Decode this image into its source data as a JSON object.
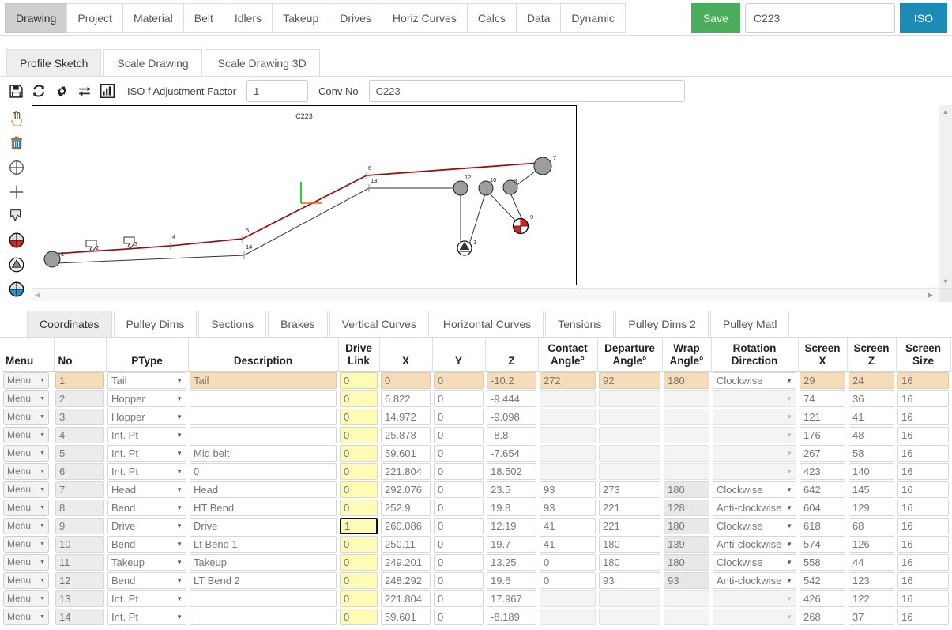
{
  "topnav": {
    "tabs": [
      {
        "label": "Drawing",
        "active": true
      },
      {
        "label": "Project",
        "active": false
      },
      {
        "label": "Material",
        "active": false
      },
      {
        "label": "Belt",
        "active": false
      },
      {
        "label": "Idlers",
        "active": false
      },
      {
        "label": "Takeup",
        "active": false
      },
      {
        "label": "Drives",
        "active": false
      },
      {
        "label": "Horiz Curves",
        "active": false
      },
      {
        "label": "Calcs",
        "active": false
      },
      {
        "label": "Data",
        "active": false
      },
      {
        "label": "Dynamic",
        "active": false
      }
    ],
    "save_label": "Save",
    "conv_value": "C223",
    "iso_label": "ISO",
    "save_color": "#4cae5c",
    "iso_color": "#1b8cb5"
  },
  "subtabs": [
    {
      "label": "Profile Sketch",
      "active": true
    },
    {
      "label": "Scale Drawing",
      "active": false
    },
    {
      "label": "Scale Drawing 3D",
      "active": false
    }
  ],
  "toolbar": {
    "icons": [
      "save-icon",
      "refresh-icon",
      "gear-icon",
      "swap-icon",
      "chart-icon"
    ],
    "factor_label": "ISO f Adjustment Factor",
    "factor_value": "1",
    "convno_label": "Conv No",
    "convno_value": "C223"
  },
  "sidetools": [
    "pan-hand-icon",
    "delete-trash-icon",
    "crosshair-circle-icon",
    "add-plus-icon",
    "pointer-select-icon",
    "red-pulley-icon",
    "takeup-triangle-icon",
    "blue-pulley-icon"
  ],
  "drawing": {
    "title": "C223",
    "point_labels": [
      "1",
      "2",
      "3",
      "4",
      "5",
      "6",
      "7",
      "8",
      "9",
      "10",
      "12",
      "13",
      "14"
    ]
  },
  "lowtabs": [
    {
      "label": "Coordinates",
      "active": true
    },
    {
      "label": "Pulley Dims",
      "active": false
    },
    {
      "label": "Sections",
      "active": false
    },
    {
      "label": "Brakes",
      "active": false
    },
    {
      "label": "Vertical Curves",
      "active": false
    },
    {
      "label": "Horizontal Curves",
      "active": false
    },
    {
      "label": "Tensions",
      "active": false
    },
    {
      "label": "Pulley Dims 2",
      "active": false
    },
    {
      "label": "Pulley Matl",
      "active": false
    }
  ],
  "table": {
    "headers": [
      "Menu",
      "No",
      "PType",
      "Description",
      "Drive Link",
      "X",
      "Y",
      "Z",
      "Contact Angle°",
      "Departure Angle°",
      "Wrap Angle°",
      "Rotation Direction",
      "Screen X",
      "Screen Z",
      "Screen Size"
    ],
    "menu_label": "Menu",
    "rows": [
      {
        "no": "1",
        "ptype": "Tail",
        "desc": "Tail",
        "drive": "0",
        "x": "0",
        "y": "0",
        "z": "-10.2",
        "contact": "272",
        "departure": "92",
        "wrap": "180",
        "rot": "Clockwise",
        "sx": "29",
        "sz": "24",
        "ssize": "16",
        "highlight": true,
        "focus": false
      },
      {
        "no": "2",
        "ptype": "Hopper",
        "desc": "",
        "drive": "0",
        "x": "6.822",
        "y": "0",
        "z": "-9.444",
        "contact": "",
        "departure": "",
        "wrap": "",
        "rot": "",
        "sx": "74",
        "sz": "36",
        "ssize": "16",
        "highlight": false,
        "focus": false
      },
      {
        "no": "3",
        "ptype": "Hopper",
        "desc": "",
        "drive": "0",
        "x": "14.972",
        "y": "0",
        "z": "-9.098",
        "contact": "",
        "departure": "",
        "wrap": "",
        "rot": "",
        "sx": "121",
        "sz": "41",
        "ssize": "16",
        "highlight": false,
        "focus": false
      },
      {
        "no": "4",
        "ptype": "Int. Pt",
        "desc": "",
        "drive": "0",
        "x": "25.878",
        "y": "0",
        "z": "-8.8",
        "contact": "",
        "departure": "",
        "wrap": "",
        "rot": "",
        "sx": "176",
        "sz": "48",
        "ssize": "16",
        "highlight": false,
        "focus": false
      },
      {
        "no": "5",
        "ptype": "Int. Pt",
        "desc": "Mid belt",
        "drive": "0",
        "x": "59.601",
        "y": "0",
        "z": "-7.654",
        "contact": "",
        "departure": "",
        "wrap": "",
        "rot": "",
        "sx": "267",
        "sz": "58",
        "ssize": "16",
        "highlight": false,
        "focus": false
      },
      {
        "no": "6",
        "ptype": "Int. Pt",
        "desc": "0",
        "drive": "0",
        "x": "221.804",
        "y": "0",
        "z": "18.502",
        "contact": "",
        "departure": "",
        "wrap": "",
        "rot": "",
        "sx": "423",
        "sz": "140",
        "ssize": "16",
        "highlight": false,
        "focus": false
      },
      {
        "no": "7",
        "ptype": "Head",
        "desc": "Head",
        "drive": "0",
        "x": "292.076",
        "y": "0",
        "z": "23.5",
        "contact": "93",
        "departure": "273",
        "wrap": "180",
        "rot": "Clockwise",
        "sx": "642",
        "sz": "145",
        "ssize": "16",
        "highlight": false,
        "focus": false
      },
      {
        "no": "8",
        "ptype": "Bend",
        "desc": "HT Bend",
        "drive": "0",
        "x": "252.9",
        "y": "0",
        "z": "19.8",
        "contact": "93",
        "departure": "221",
        "wrap": "128",
        "rot": "Anti-clockwise",
        "sx": "604",
        "sz": "129",
        "ssize": "16",
        "highlight": false,
        "focus": false
      },
      {
        "no": "9",
        "ptype": "Drive",
        "desc": "Drive",
        "drive": "1",
        "x": "260.086",
        "y": "0",
        "z": "12.19",
        "contact": "41",
        "departure": "221",
        "wrap": "180",
        "rot": "Clockwise",
        "sx": "618",
        "sz": "68",
        "ssize": "16",
        "highlight": false,
        "focus": true
      },
      {
        "no": "10",
        "ptype": "Bend",
        "desc": "Lt Bend 1",
        "drive": "0",
        "x": "250.11",
        "y": "0",
        "z": "19.7",
        "contact": "41",
        "departure": "180",
        "wrap": "139",
        "rot": "Anti-clockwise",
        "sx": "574",
        "sz": "126",
        "ssize": "16",
        "highlight": false,
        "focus": false
      },
      {
        "no": "11",
        "ptype": "Takeup",
        "desc": "Takeup",
        "drive": "0",
        "x": "249.201",
        "y": "0",
        "z": "13.25",
        "contact": "0",
        "departure": "180",
        "wrap": "180",
        "rot": "Clockwise",
        "sx": "558",
        "sz": "44",
        "ssize": "16",
        "highlight": false,
        "focus": false
      },
      {
        "no": "12",
        "ptype": "Bend",
        "desc": "LT Bend 2",
        "drive": "0",
        "x": "248.292",
        "y": "0",
        "z": "19.6",
        "contact": "0",
        "departure": "93",
        "wrap": "93",
        "rot": "Anti-clockwise",
        "sx": "542",
        "sz": "123",
        "ssize": "16",
        "highlight": false,
        "focus": false
      },
      {
        "no": "13",
        "ptype": "Int. Pt",
        "desc": "",
        "drive": "0",
        "x": "221.804",
        "y": "0",
        "z": "17.967",
        "contact": "",
        "departure": "",
        "wrap": "",
        "rot": "",
        "sx": "426",
        "sz": "122",
        "ssize": "16",
        "highlight": false,
        "focus": false
      },
      {
        "no": "14",
        "ptype": "Int. Pt",
        "desc": "",
        "drive": "0",
        "x": "59.601",
        "y": "0",
        "z": "-8.189",
        "contact": "",
        "departure": "",
        "wrap": "",
        "rot": "",
        "sx": "268",
        "sz": "37",
        "ssize": "16",
        "highlight": false,
        "focus": false
      }
    ]
  }
}
